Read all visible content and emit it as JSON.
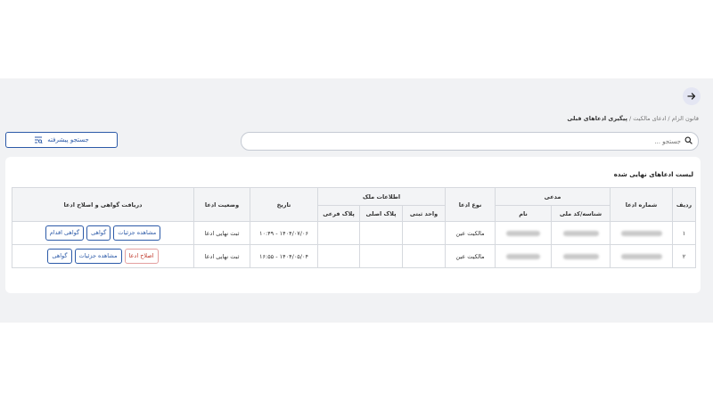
{
  "nav": {
    "back_icon": "arrow-right-icon"
  },
  "breadcrumb": {
    "items": [
      "قانون الزام",
      "ادعای مالکیت"
    ],
    "separator": " / ",
    "current": "پیگیری ادعاهای قبلی"
  },
  "search": {
    "placeholder": "جستجو ...",
    "value": ""
  },
  "advanced_search": {
    "label": "جستجو پیشرفته"
  },
  "table_section": {
    "title": "لیست ادعاهای نهایی شده",
    "headers": {
      "row": "ردیف",
      "claim_number": "شماره ادعا",
      "claimant": "مدعی",
      "claimant_id": "شناسه/کد ملی",
      "claimant_name": "نام",
      "claim_type": "نوع ادعا",
      "property_info": "اطلاعات ملک",
      "registration_unit": "واحد ثبتی",
      "main_plate": "پلاک اصلی",
      "sub_plate": "پلاک فرعی",
      "date": "تاریخ",
      "claim_status": "وضعیت ادعا",
      "certificate": "دریافت گواهی و اصلاح ادعا"
    },
    "rows": [
      {
        "row": "۱",
        "claim_type": "مالکیت عین",
        "date": "۱۴۰۴/۰۷/۰۶ - ۱۰:۴۹",
        "status": "ثبت نهایی ادعا",
        "actions": [
          "مشاهده جزئیات",
          "گواهی",
          "گواهی اقدام"
        ]
      },
      {
        "row": "۲",
        "claim_type": "مالکیت عین",
        "date": "۱۴۰۴/۰۵/۰۴ - ۱۶:۵۵",
        "status": "ثبت نهایی ادعا",
        "actions": [
          "اصلاح ادعا",
          "مشاهده جزئیات",
          "گواهی"
        ]
      }
    ]
  },
  "colors": {
    "primary": "#2c5aa8",
    "danger": "#c0392b",
    "background": "#f1f2f4"
  }
}
